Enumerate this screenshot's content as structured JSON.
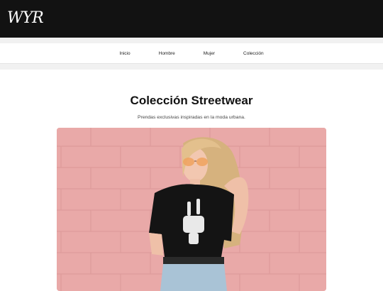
{
  "header": {
    "logo_text": "WYR"
  },
  "nav": {
    "items": [
      "Inicio",
      "Hombre",
      "Mujer",
      "Colección"
    ]
  },
  "main": {
    "title": "Colección Streetwear",
    "subtitle": "Prendas exclusivas inspiradas en la moda urbana.",
    "hero_image": "woman-wearing-skeleton-hand-tshirt-pink-wall"
  },
  "colors": {
    "header_bg": "#121212",
    "wall_pink": "#e8a7a6"
  }
}
